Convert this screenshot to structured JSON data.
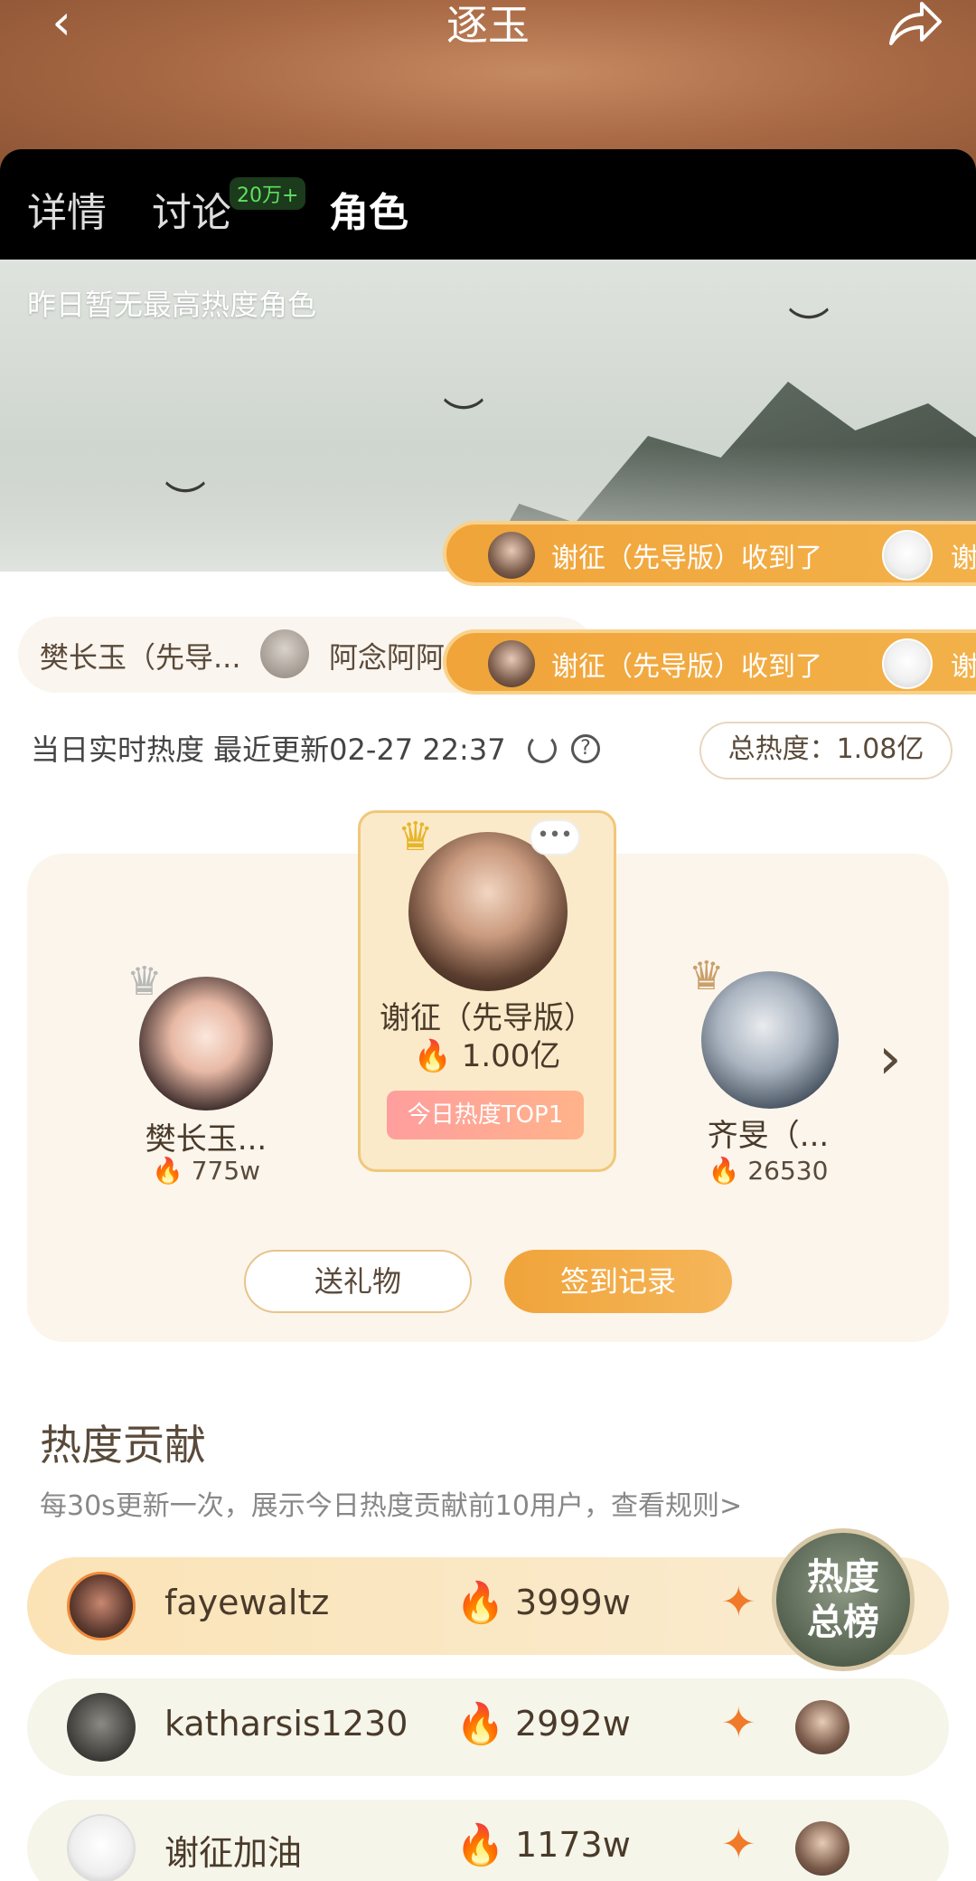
{
  "header": {
    "title": "逐玉",
    "back_icon": "chevron-left-icon",
    "share_icon": "share-icon"
  },
  "tabs": [
    {
      "label": "详情"
    },
    {
      "label": "讨论",
      "badge": "20万+"
    },
    {
      "label": "角色",
      "active": true
    }
  ],
  "banner": {
    "text": "昨日暂无最高热度角色"
  },
  "marquee": [
    {
      "text": "谢征（先导版）收到了",
      "tail": "谢"
    },
    {
      "text": "谢征（先导版）收到了",
      "tail": "谢"
    }
  ],
  "strip": {
    "name1": "樊长玉（先导...",
    "name2": "阿念阿阿"
  },
  "heat_info": {
    "label": "当日实时热度 最近更新02-27 22:37",
    "total": "总热度：1.08亿"
  },
  "podium": {
    "first": {
      "name": "谢征（先导版）",
      "heat": "1.00亿",
      "badge": "今日热度TOP1",
      "more": "•••"
    },
    "second": {
      "name": "樊长玉...",
      "heat": "775w",
      "rank": "2"
    },
    "third": {
      "name": "齐旻（...",
      "heat": "26530",
      "rank": "3"
    }
  },
  "buttons": {
    "gift": "送礼物",
    "sign": "签到记录"
  },
  "contribution": {
    "title": "热度贡献",
    "subtitle": "每30s更新一次，展示今日热度贡献前10用户，查看规则>",
    "rows": [
      {
        "name": "fayewaltz",
        "heat": "3999w"
      },
      {
        "name": "katharsis1230",
        "heat": "2992w"
      },
      {
        "name": "谢征加油",
        "heat": "1173w"
      }
    ]
  },
  "float_button": {
    "line1": "热度",
    "line2": "总榜"
  },
  "colors": {
    "accent": "#f0a43a",
    "flame": "#ff5a1f",
    "tab_bg": "#000000"
  }
}
